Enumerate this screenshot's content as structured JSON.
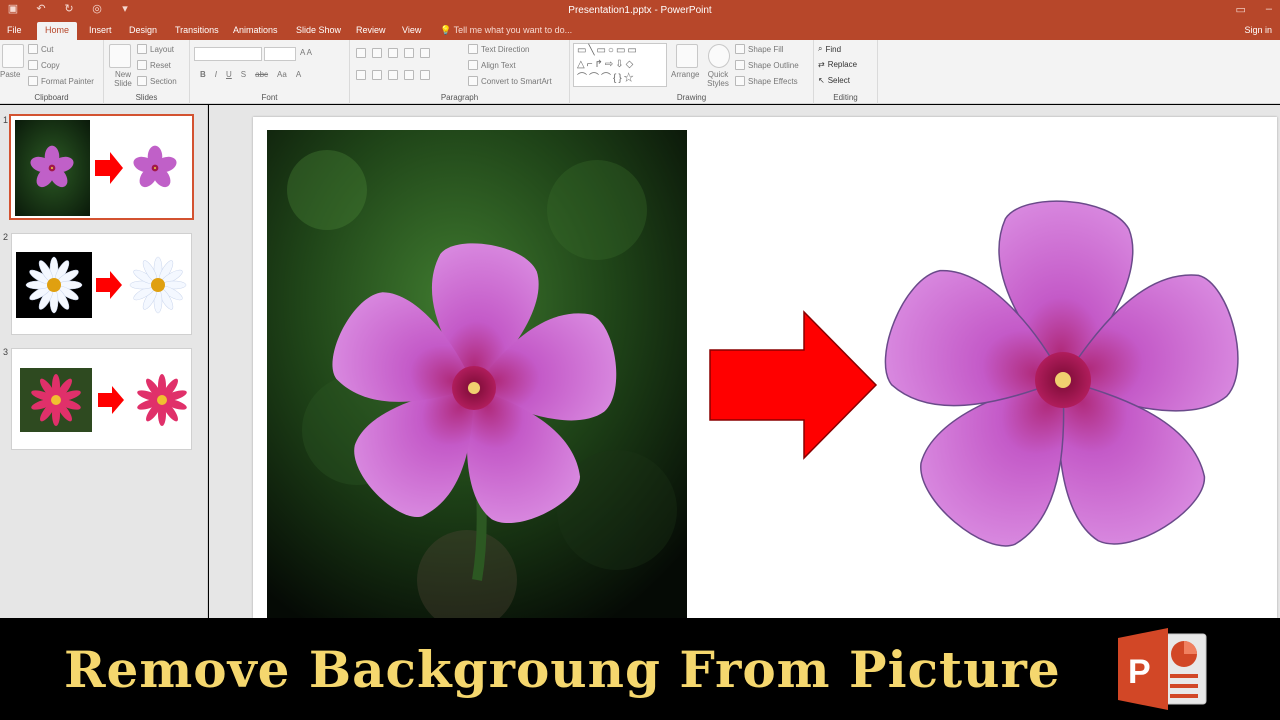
{
  "titlebar": {
    "title": "Presentation1.pptx - PowerPoint",
    "qat_icons": [
      "save-icon",
      "undo-icon",
      "redo-icon",
      "present-icon",
      "customize-icon"
    ],
    "window_controls": [
      "ribbon-options-icon",
      "minimize-icon",
      "maximize-icon",
      "close-icon"
    ]
  },
  "tabs": {
    "items": [
      "File",
      "Home",
      "Insert",
      "Design",
      "Transitions",
      "Animations",
      "Slide Show",
      "Review",
      "View"
    ],
    "active": "Home",
    "tell_me": "Tell me what you want to do...",
    "sign_in": "Sign in"
  },
  "ribbon": {
    "clipboard": {
      "label": "Clipboard",
      "paste": "Paste",
      "cut": "Cut",
      "copy": "Copy",
      "format_painter": "Format Painter"
    },
    "slides": {
      "label": "Slides",
      "new_slide": "New Slide",
      "layout": "Layout",
      "reset": "Reset",
      "section": "Section"
    },
    "font": {
      "label": "Font",
      "bold": "B",
      "italic": "I",
      "underline": "U",
      "shadow": "S",
      "strike": "abc",
      "aa": "Aa",
      "font_color": "A"
    },
    "paragraph": {
      "label": "Paragraph",
      "text_direction": "Text Direction",
      "align_text": "Align Text",
      "smartart": "Convert to SmartArt"
    },
    "drawing": {
      "label": "Drawing",
      "arrange": "Arrange",
      "quick_styles": "Quick Styles",
      "shape_fill": "Shape Fill",
      "shape_outline": "Shape Outline",
      "shape_effects": "Shape Effects"
    },
    "editing": {
      "label": "Editing",
      "find": "Find",
      "replace": "Replace",
      "select": "Select"
    }
  },
  "slides_panel": [
    {
      "number": "1",
      "subject": "Periwinkle flower",
      "selected": true
    },
    {
      "number": "2",
      "subject": "Daisy",
      "selected": false
    },
    {
      "number": "3",
      "subject": "Dahlia",
      "selected": false
    }
  ],
  "banner": {
    "text": "Remove Backgroung From Picture",
    "text_color": "#f5d76e"
  },
  "colors": {
    "accent": "#b7472a",
    "selection": "#d35230",
    "arrow": "#ff0000"
  }
}
